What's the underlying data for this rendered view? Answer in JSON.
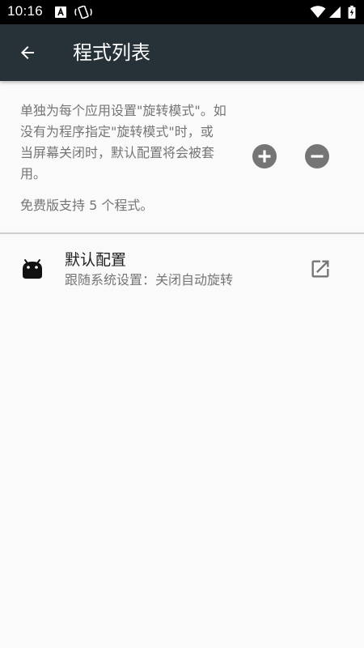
{
  "status_bar": {
    "time": "10:16",
    "icons": [
      "keyboard-a-icon",
      "rotate-phone-icon",
      "wifi-icon",
      "cell-signal-icon",
      "battery-charging-icon"
    ]
  },
  "toolbar": {
    "title": "程式列表",
    "back_icon": "arrow-back-icon",
    "color": "#263238"
  },
  "info": {
    "line1": "单独为每个应用设置\"旋转模式\"。如",
    "line2": "没有为程序指定\"旋转模式\"时，或",
    "line3": "当屏幕关闭时，默认配置将会被套",
    "line4": "用。",
    "add_icon": "add-circle-icon",
    "remove_icon": "remove-circle-icon",
    "free_note": "免费版支持 5 个程式。"
  },
  "profiles": [
    {
      "name": "默认配置",
      "description": "跟随系统设置：关闭自动旋转",
      "icon": "android-icon",
      "action_icon": "open-external-icon"
    }
  ]
}
